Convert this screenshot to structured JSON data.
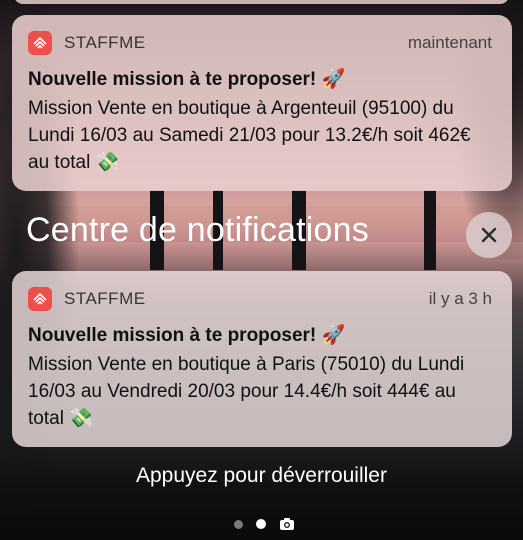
{
  "notifications": [
    {
      "app_name": "STAFFME",
      "time": "maintenant",
      "title": "Nouvelle mission à te proposer! 🚀",
      "body": "Mission Vente en boutique à Argenteuil (95100) du Lundi 16/03 au Samedi 21/03 pour 13.2€/h soit 462€ au total 💸"
    },
    {
      "app_name": "STAFFME",
      "time": "il y a 3 h",
      "title": "Nouvelle mission à te proposer! 🚀",
      "body": "Mission Vente en boutique à Paris (75010) du Lundi 16/03 au Vendredi 20/03 pour 14.4€/h soit 444€ au total 💸"
    }
  ],
  "section": {
    "title": "Centre de notifications",
    "close_icon": "close-icon"
  },
  "lockscreen": {
    "unlock_text": "Appuyez pour déverrouiller"
  },
  "pager": {
    "dots": 2,
    "active": 2,
    "camera_icon": "camera-icon"
  },
  "colors": {
    "app_icon": "#ec4f4c"
  }
}
